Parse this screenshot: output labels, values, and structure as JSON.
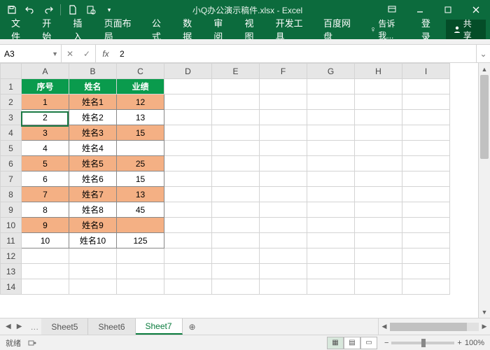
{
  "title": "小Q办公演示稿件.xlsx - Excel",
  "ribbon_tabs": [
    "文件",
    "开始",
    "插入",
    "页面布局",
    "公式",
    "数据",
    "审阅",
    "视图",
    "开发工具",
    "百度网盘"
  ],
  "tell_me": "告诉我...",
  "login": "登录",
  "share": "共享",
  "name_box": "A3",
  "formula": "2",
  "columns": [
    "A",
    "B",
    "C",
    "D",
    "E",
    "F",
    "G",
    "H",
    "I"
  ],
  "row_count": 14,
  "selected_row": 3,
  "chart_data": {
    "type": "table",
    "headers": [
      "序号",
      "姓名",
      "业绩"
    ],
    "rows": [
      [
        "1",
        "姓名1",
        "12"
      ],
      [
        "2",
        "姓名2",
        "13"
      ],
      [
        "3",
        "姓名3",
        "15"
      ],
      [
        "4",
        "姓名4",
        ""
      ],
      [
        "5",
        "姓名5",
        "25"
      ],
      [
        "6",
        "姓名6",
        "15"
      ],
      [
        "7",
        "姓名7",
        "13"
      ],
      [
        "8",
        "姓名8",
        "45"
      ],
      [
        "9",
        "姓名9",
        ""
      ],
      [
        "10",
        "姓名10",
        "125"
      ]
    ]
  },
  "sheets": [
    "Sheet5",
    "Sheet6",
    "Sheet7"
  ],
  "active_sheet": "Sheet7",
  "status": "就绪",
  "zoom": "100%",
  "colors": {
    "green": "#0c6b3d",
    "header_green": "#0a9b4d",
    "alt_fill": "#f4b084"
  }
}
